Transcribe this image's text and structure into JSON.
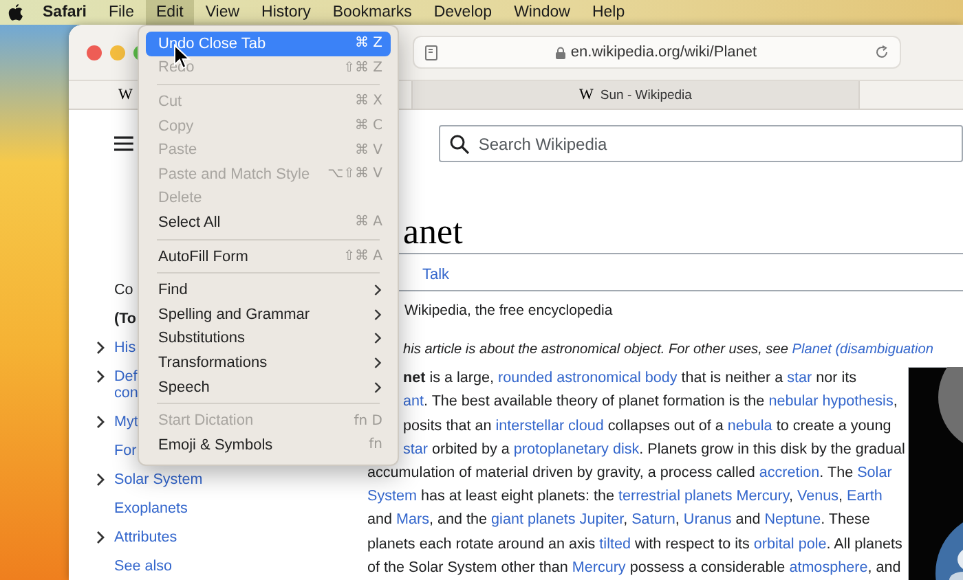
{
  "menu_bar": {
    "items": [
      {
        "label": "Safari",
        "kind": "app",
        "selected": false
      },
      {
        "label": "File",
        "kind": "menu",
        "selected": false
      },
      {
        "label": "Edit",
        "kind": "menu",
        "selected": true
      },
      {
        "label": "View",
        "kind": "menu",
        "selected": false
      },
      {
        "label": "History",
        "kind": "menu",
        "selected": false
      },
      {
        "label": "Bookmarks",
        "kind": "menu",
        "selected": false
      },
      {
        "label": "Develop",
        "kind": "menu",
        "selected": false
      },
      {
        "label": "Window",
        "kind": "menu",
        "selected": false
      },
      {
        "label": "Help",
        "kind": "menu",
        "selected": false
      }
    ]
  },
  "edit_menu": [
    {
      "kind": "item",
      "label": "Undo Close Tab",
      "shortcut": "⌘ Z",
      "selected": true,
      "disabled": false,
      "submenu": false
    },
    {
      "kind": "item",
      "label": "Redo",
      "shortcut": "⇧⌘ Z",
      "selected": false,
      "disabled": true,
      "submenu": false
    },
    {
      "kind": "separator"
    },
    {
      "kind": "item",
      "label": "Cut",
      "shortcut": "⌘ X",
      "selected": false,
      "disabled": true,
      "submenu": false
    },
    {
      "kind": "item",
      "label": "Copy",
      "shortcut": "⌘ C",
      "selected": false,
      "disabled": true,
      "submenu": false
    },
    {
      "kind": "item",
      "label": "Paste",
      "shortcut": "⌘ V",
      "selected": false,
      "disabled": true,
      "submenu": false
    },
    {
      "kind": "item",
      "label": "Paste and Match Style",
      "shortcut": "⌥⇧⌘ V",
      "selected": false,
      "disabled": true,
      "submenu": false
    },
    {
      "kind": "item",
      "label": "Delete",
      "selected": false,
      "disabled": true,
      "submenu": false
    },
    {
      "kind": "item",
      "label": "Select All",
      "shortcut": "⌘ A",
      "selected": false,
      "disabled": false,
      "submenu": false
    },
    {
      "kind": "separator"
    },
    {
      "kind": "item",
      "label": "AutoFill Form",
      "shortcut": "⇧⌘ A",
      "selected": false,
      "disabled": false,
      "submenu": false
    },
    {
      "kind": "separator"
    },
    {
      "kind": "item",
      "label": "Find",
      "selected": false,
      "disabled": false,
      "submenu": true
    },
    {
      "kind": "item",
      "label": "Spelling and Grammar",
      "selected": false,
      "disabled": false,
      "submenu": true
    },
    {
      "kind": "item",
      "label": "Substitutions",
      "selected": false,
      "disabled": false,
      "submenu": true
    },
    {
      "kind": "item",
      "label": "Transformations",
      "selected": false,
      "disabled": false,
      "submenu": true
    },
    {
      "kind": "item",
      "label": "Speech",
      "selected": false,
      "disabled": false,
      "submenu": true
    },
    {
      "kind": "separator"
    },
    {
      "kind": "item",
      "label": "Start Dictation",
      "shortcut": "fn D",
      "selected": false,
      "disabled": true,
      "submenu": false
    },
    {
      "kind": "item",
      "label": "Emoji & Symbols",
      "shortcut": "fn",
      "selected": false,
      "disabled": false,
      "submenu": false
    }
  ],
  "toolbar": {
    "url": "en.wikipedia.org/wiki/Planet"
  },
  "tabs": [
    {
      "favicon": "W",
      "selected": true
    },
    {
      "favicon": "W",
      "title": "Sun - Wikipedia",
      "selected": false
    }
  ],
  "search": {
    "placeholder": "Search Wikipedia"
  },
  "sidebar": [
    {
      "kind": "heading",
      "text": "Co",
      "expandable": false
    },
    {
      "kind": "top",
      "text": "(To",
      "expandable": false
    },
    {
      "kind": "link",
      "text": "His",
      "expandable": true
    },
    {
      "kind": "link",
      "text": "Def\ncon",
      "expandable": true
    },
    {
      "kind": "link",
      "text": "Myt",
      "expandable": true
    },
    {
      "kind": "link",
      "text": "For",
      "expandable": false
    },
    {
      "kind": "link",
      "text": "Solar System",
      "expandable": true
    },
    {
      "kind": "link",
      "text": "Exoplanets",
      "expandable": false
    },
    {
      "kind": "link",
      "text": "Attributes",
      "expandable": true
    },
    {
      "kind": "link",
      "text": "See also",
      "expandable": false
    }
  ],
  "article": {
    "title": {
      "text": "anet",
      "partial": true
    },
    "talk_tab": "Talk",
    "tagline": {
      "text": "Wikipedia, the free encyclopedia",
      "partial": true
    },
    "hatnote": {
      "partial": true,
      "segments": [
        {
          "kind": "text",
          "text": "his article is about the astronomical object. For other uses, see "
        },
        {
          "kind": "link",
          "text": "Planet (disambiguation"
        }
      ]
    },
    "lines": [
      {
        "partial": true,
        "segments": [
          {
            "kind": "text",
            "text": "**net** is a large, "
          },
          {
            "kind": "link",
            "text": "rounded astronomical body"
          },
          {
            "kind": "text",
            "text": " that is neither a "
          },
          {
            "kind": "link",
            "text": "star"
          },
          {
            "kind": "text",
            "text": " nor its"
          }
        ]
      },
      {
        "partial": true,
        "segments": [
          {
            "kind": "link",
            "text": "ant"
          },
          {
            "kind": "text",
            "text": ". The best available theory of planet formation is the "
          },
          {
            "kind": "link",
            "text": "nebular hypothesis"
          },
          {
            "kind": "text",
            "text": ","
          }
        ]
      },
      {
        "partial": true,
        "segments": [
          {
            "kind": "text",
            "text": "posits that an "
          },
          {
            "kind": "link",
            "text": "interstellar cloud"
          },
          {
            "kind": "text",
            "text": " collapses out of a "
          },
          {
            "kind": "link",
            "text": "nebula"
          },
          {
            "kind": "text",
            "text": " to create a young"
          }
        ]
      },
      {
        "partial": true,
        "segments": [
          {
            "kind": "link",
            "text": "star"
          },
          {
            "kind": "text",
            "text": " orbited by a "
          },
          {
            "kind": "link",
            "text": "protoplanetary disk"
          },
          {
            "kind": "text",
            "text": ". Planets grow in this disk by the gradual"
          }
        ]
      },
      {
        "segments": [
          {
            "kind": "text",
            "text": "accumulation of material driven by gravity, a process called "
          },
          {
            "kind": "link",
            "text": "accretion"
          },
          {
            "kind": "text",
            "text": ". The "
          },
          {
            "kind": "link",
            "text": "Solar"
          }
        ]
      },
      {
        "segments": [
          {
            "kind": "link",
            "text": "System"
          },
          {
            "kind": "text",
            "text": " has at least eight planets: the "
          },
          {
            "kind": "link",
            "text": "terrestrial planets"
          },
          {
            "kind": "link",
            "text": "Mercury",
            "gap": true
          },
          {
            "kind": "text",
            "text": ", "
          },
          {
            "kind": "link",
            "text": "Venus"
          },
          {
            "kind": "text",
            "text": ", "
          },
          {
            "kind": "link",
            "text": "Earth"
          }
        ]
      },
      {
        "segments": [
          {
            "kind": "text",
            "text": "and "
          },
          {
            "kind": "link",
            "text": "Mars"
          },
          {
            "kind": "text",
            "text": ", and the "
          },
          {
            "kind": "link",
            "text": "giant planets"
          },
          {
            "kind": "link",
            "text": "Jupiter",
            "gap": true
          },
          {
            "kind": "text",
            "text": ", "
          },
          {
            "kind": "link",
            "text": "Saturn"
          },
          {
            "kind": "text",
            "text": ", "
          },
          {
            "kind": "link",
            "text": "Uranus"
          },
          {
            "kind": "text",
            "text": " and "
          },
          {
            "kind": "link",
            "text": "Neptune"
          },
          {
            "kind": "text",
            "text": ". These"
          }
        ]
      },
      {
        "segments": [
          {
            "kind": "text",
            "text": "planets each rotate around an axis "
          },
          {
            "kind": "link",
            "text": "tilted"
          },
          {
            "kind": "text",
            "text": " with respect to its "
          },
          {
            "kind": "link",
            "text": "orbital pole"
          },
          {
            "kind": "text",
            "text": ". All planets"
          }
        ]
      },
      {
        "segments": [
          {
            "kind": "text",
            "text": "of the Solar System other than "
          },
          {
            "kind": "link",
            "text": "Mercury"
          },
          {
            "kind": "text",
            "text": " possess a considerable "
          },
          {
            "kind": "link",
            "text": "atmosphere"
          },
          {
            "kind": "text",
            "text": ", and"
          }
        ]
      }
    ]
  }
}
